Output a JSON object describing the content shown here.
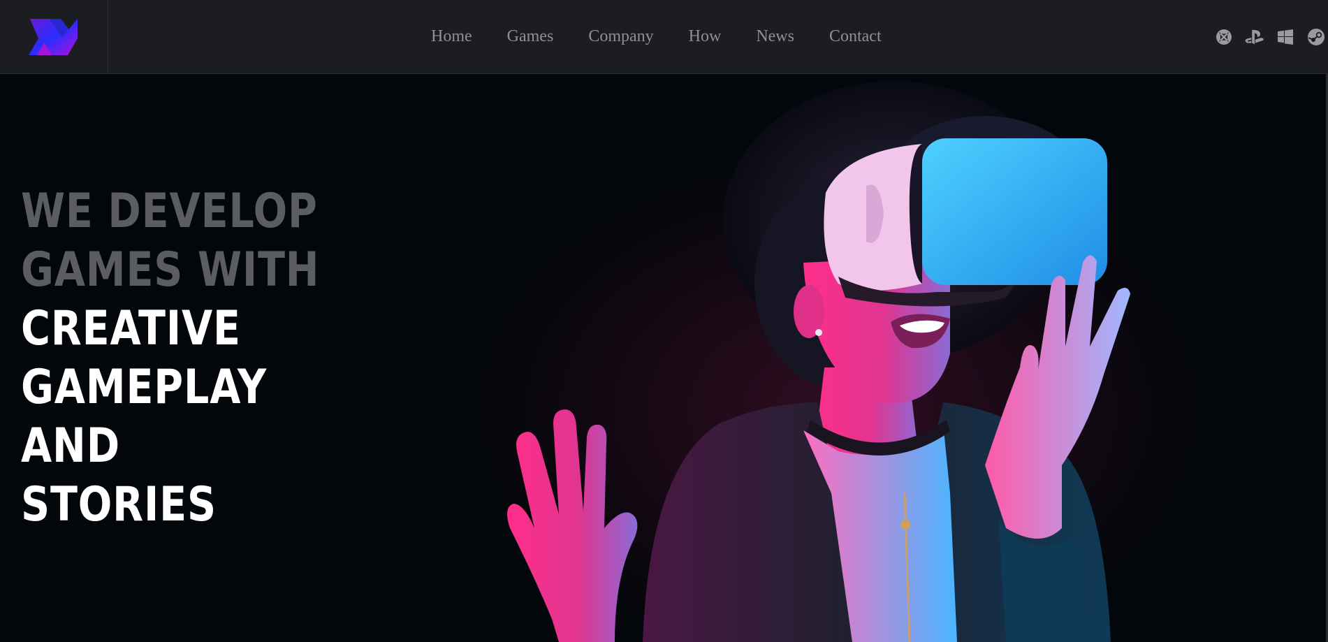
{
  "brand": {
    "logo_icon": "brand-logo-icon",
    "accent_colors": [
      "#6a1bd6",
      "#2b2cff",
      "#b012d9"
    ]
  },
  "nav": {
    "items": [
      {
        "label": "Home"
      },
      {
        "label": "Games"
      },
      {
        "label": "Company"
      },
      {
        "label": "How"
      },
      {
        "label": "News"
      },
      {
        "label": "Contact"
      }
    ]
  },
  "platforms": [
    {
      "icon": "xbox-icon"
    },
    {
      "icon": "playstation-icon"
    },
    {
      "icon": "windows-icon"
    },
    {
      "icon": "steam-icon"
    }
  ],
  "hero": {
    "headline_muted": [
      "WE DEVELOP",
      "GAMES WITH"
    ],
    "headline_bright": [
      "CREATIVE",
      "GAMEPLAY",
      "AND",
      "STORIES"
    ],
    "image": "vr-headset-woman-image",
    "colors": {
      "pink": "#ff2e8a",
      "blue": "#2ab0ff",
      "background": "#03060a"
    }
  }
}
